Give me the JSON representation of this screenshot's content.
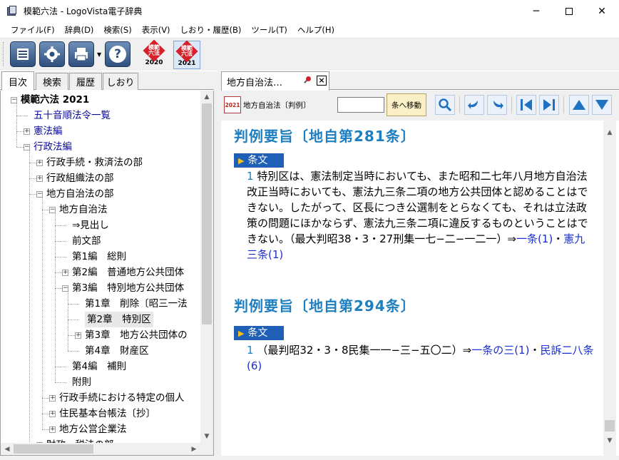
{
  "window": {
    "title": "模範六法 - LogoVista電子辞典",
    "minimize": "─",
    "close": "✕"
  },
  "menu": [
    "ファイル(F)",
    "辞典(D)",
    "検索(S)",
    "表示(V)",
    "しおり・履歴(B)",
    "ツール(T)",
    "ヘルプ(H)"
  ],
  "toolbar": {
    "help_glyph": "?",
    "books": [
      {
        "name": "模範\n六法",
        "year": "2020"
      },
      {
        "name": "模範\n六法",
        "year": "2021"
      }
    ]
  },
  "left_tabs": [
    "目次",
    "検索",
    "履歴",
    "しおり"
  ],
  "tree": [
    {
      "label": "模範六法 2021",
      "level": 0,
      "exp": "−",
      "bold": true
    },
    {
      "label": "五十音順法令一覧",
      "level": 1,
      "exp": "",
      "blue": true
    },
    {
      "label": "憲法編",
      "level": 1,
      "exp": "+",
      "blue": true
    },
    {
      "label": "行政法編",
      "level": 1,
      "exp": "−",
      "blue": true
    },
    {
      "label": "行政手続・救済法の部",
      "level": 2,
      "exp": "+"
    },
    {
      "label": "行政組織法の部",
      "level": 2,
      "exp": "+"
    },
    {
      "label": "地方自治法の部",
      "level": 2,
      "exp": "−"
    },
    {
      "label": "地方自治法",
      "level": 3,
      "exp": "−"
    },
    {
      "label": "⇒見出し",
      "level": 4,
      "exp": ""
    },
    {
      "label": "前文部",
      "level": 4,
      "exp": ""
    },
    {
      "label": "第1編　総則",
      "level": 4,
      "exp": ""
    },
    {
      "label": "第2編　普通地方公共団体",
      "level": 4,
      "exp": "+"
    },
    {
      "label": "第3編　特別地方公共団体",
      "level": 4,
      "exp": "−"
    },
    {
      "label": "第1章　削除〔昭三一法",
      "level": 5,
      "exp": ""
    },
    {
      "label": "第2章　特別区",
      "level": 5,
      "exp": "",
      "selected": true
    },
    {
      "label": "第3章　地方公共団体の",
      "level": 5,
      "exp": "+"
    },
    {
      "label": "第4章　財産区",
      "level": 5,
      "exp": ""
    },
    {
      "label": "第4編　補則",
      "level": 4,
      "exp": ""
    },
    {
      "label": "附則",
      "level": 4,
      "exp": ""
    },
    {
      "label": "行政手続における特定の個人",
      "level": 3,
      "exp": "+"
    },
    {
      "label": "住民基本台帳法〔抄〕",
      "level": 3,
      "exp": "+"
    },
    {
      "label": "地方公営企業法",
      "level": 3,
      "exp": "+"
    },
    {
      "label": "財政・税法の部",
      "level": 2,
      "exp": "+"
    }
  ],
  "doc_tab": {
    "label": "地方自治法…"
  },
  "doc_toolbar": {
    "book_badge": "2021",
    "book_label": "地方自治法〔判例〕",
    "goto_value": "",
    "goto_button": "条へ移動"
  },
  "content": {
    "jou_label": "条文",
    "sections": [
      {
        "title": "判例要旨〔地自第281条〕",
        "num": "1",
        "text": " 特別区は、憲法制定当時においても、また昭和二七年八月地方自治法改正当時においても、憲法九三条二項の地方公共団体と認めることはできない。したがって、区長につき公選制をとらなくても、それは立法政策の問題にほかならず、憲法九三条二項に違反するものということはできない。（最大判昭38・3・27刑集一七−二−一二一）⇒",
        "link1": "一条(1)",
        "sep": "・",
        "link2": "憲九三条(1)"
      },
      {
        "title": "判例要旨〔地自第294条〕",
        "num": "1",
        "text": " （最判昭32・3・8民集一一−三−五〇二）⇒",
        "link1": "一条の三(1)",
        "sep": "・",
        "link2": "民訴二八条(6)"
      }
    ]
  }
}
